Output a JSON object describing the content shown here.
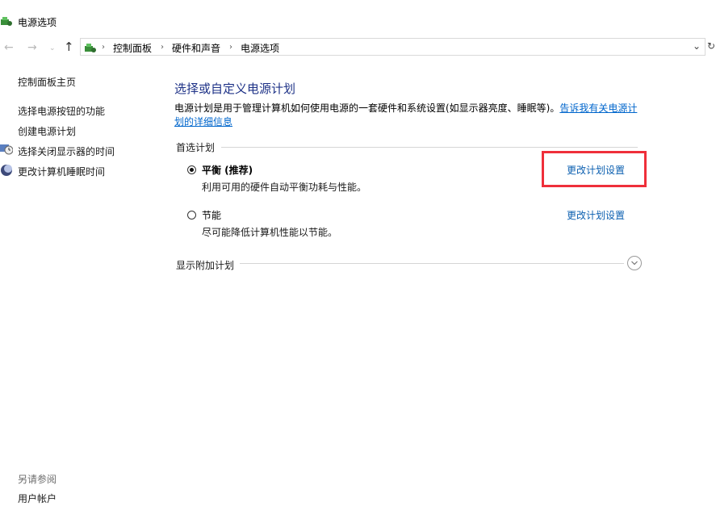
{
  "window": {
    "title": "电源选项"
  },
  "nav": {
    "back": "←",
    "forward": "→",
    "recent": "⌄",
    "up": "↑",
    "dropdown": "⌄",
    "refresh": "↻"
  },
  "address": {
    "crumbs": [
      "控制面板",
      "硬件和声音",
      "电源选项"
    ],
    "separator": "›"
  },
  "sidebar": {
    "home": "控制面板主页",
    "items": [
      "选择电源按钮的功能",
      "创建电源计划",
      "选择关闭显示器的时间",
      "更改计算机睡眠时间"
    ],
    "see_also": "另请参阅",
    "user_accounts": "用户帐户"
  },
  "main": {
    "heading": "选择或自定义电源计划",
    "description": "电源计划是用于管理计算机如何使用电源的一套硬件和系统设置(如显示器亮度、睡眠等)。",
    "description_link": "告诉我有关电源计划的详细信息",
    "preferred_label": "首选计划",
    "plans": [
      {
        "name": "平衡 (推荐)",
        "desc": "利用可用的硬件自动平衡功耗与性能。",
        "link": "更改计划设置",
        "selected": true
      },
      {
        "name": "节能",
        "desc": "尽可能降低计算机性能以节能。",
        "link": "更改计划设置",
        "selected": false
      }
    ],
    "additional_label": "显示附加计划",
    "expand_icon": "chevron-down-circle-icon"
  },
  "colors": {
    "heading": "#1e3287",
    "link": "#0b5fb0",
    "highlight": "#ef2f3a"
  }
}
